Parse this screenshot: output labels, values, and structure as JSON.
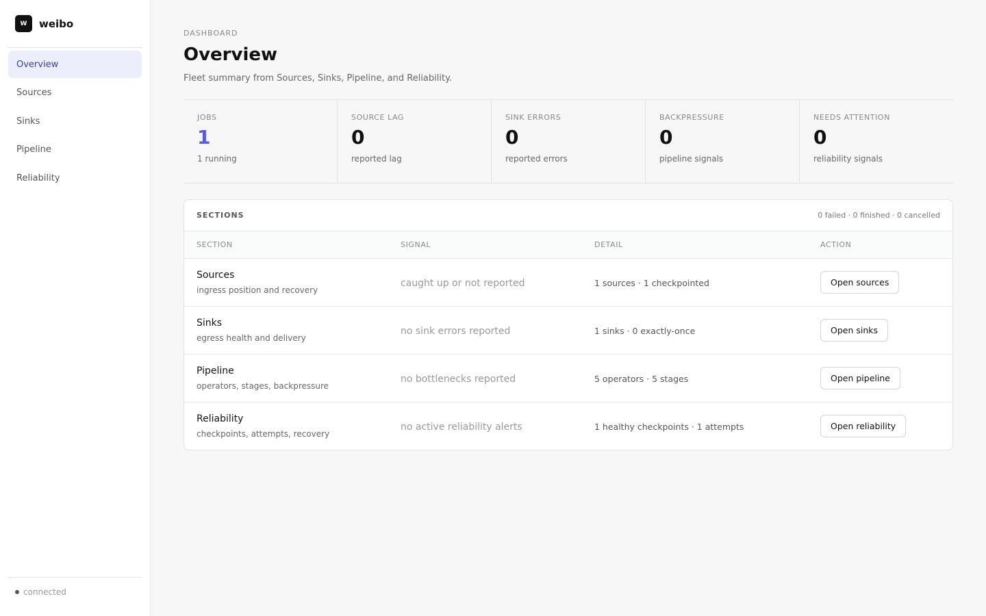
{
  "app": {
    "name": "weibo",
    "logo_text": "W"
  },
  "sidebar": {
    "items": [
      {
        "label": "Overview",
        "active": true
      },
      {
        "label": "Sources"
      },
      {
        "label": "Sinks"
      },
      {
        "label": "Pipeline"
      },
      {
        "label": "Reliability"
      }
    ],
    "status": "connected"
  },
  "header": {
    "eyebrow": "DASHBOARD",
    "title": "Overview",
    "subtitle": "Fleet summary from Sources, Sinks, Pipeline, and Reliability."
  },
  "stats": [
    {
      "label": "JOBS",
      "value": "1",
      "sub": "1 running",
      "accent": "#5b5bd6"
    },
    {
      "label": "SOURCE LAG",
      "value": "0",
      "sub": "reported lag"
    },
    {
      "label": "SINK ERRORS",
      "value": "0",
      "sub": "reported errors"
    },
    {
      "label": "BACKPRESSURE",
      "value": "0",
      "sub": "pipeline signals"
    },
    {
      "label": "NEEDS ATTENTION",
      "value": "0",
      "sub": "reliability signals"
    }
  ],
  "sections": {
    "title": "SECTIONS",
    "meta": "0 failed · 0 finished · 0 cancelled",
    "columns": [
      "SECTION",
      "SIGNAL",
      "DETAIL",
      "ACTION"
    ],
    "rows": [
      {
        "name": "Sources",
        "desc": "ingress position and recovery",
        "signal": "caught up or not reported",
        "detail": "1 sources · 1 checkpointed",
        "action": "Open sources"
      },
      {
        "name": "Sinks",
        "desc": "egress health and delivery",
        "signal": "no sink errors reported",
        "detail": "1 sinks · 0 exactly-once",
        "action": "Open sinks"
      },
      {
        "name": "Pipeline",
        "desc": "operators, stages, backpressure",
        "signal": "no bottlenecks reported",
        "detail": "5 operators · 5 stages",
        "action": "Open pipeline"
      },
      {
        "name": "Reliability",
        "desc": "checkpoints, attempts, recovery",
        "signal": "no active reliability alerts",
        "detail": "1 healthy checkpoints · 1 attempts",
        "action": "Open reliability"
      }
    ]
  }
}
